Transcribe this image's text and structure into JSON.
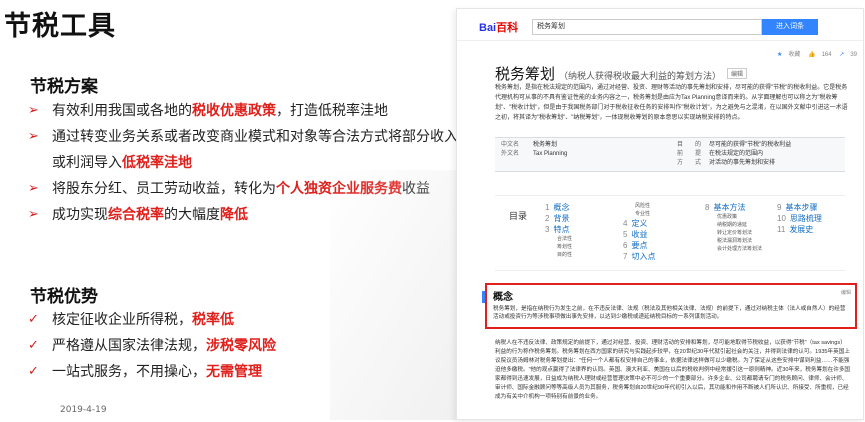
{
  "slide": {
    "title": "节税工具",
    "date": "2019-4-19"
  },
  "plan": {
    "title": "节税方案",
    "items": [
      {
        "t1": "有效利用我国或各地的",
        "h1": "税收优惠政策",
        "t2": "，打造低税率洼地"
      },
      {
        "t1": "通过转变业务关系或者改变商业模式和对象等合法方式将部分收入或利润导入",
        "h1": "低税率洼地",
        "t2": ""
      },
      {
        "t1": "将股东分红、员工劳动收益，转化为",
        "h1": "个人独资企业服务费",
        "t2": "收益"
      },
      {
        "t1": "成功实现",
        "h1": "综合税率",
        "t2": "的大幅度",
        "h2": "降低"
      }
    ]
  },
  "advantage": {
    "title": "节税优势",
    "items": [
      {
        "t1": "核定征收企业所得税，",
        "h1": "税率低"
      },
      {
        "t1": "严格遵从国家法律法规，",
        "h1": "涉税零风险"
      },
      {
        "t1": "一站式服务，不用操心，",
        "h1": "无需管理"
      }
    ]
  },
  "baike": {
    "logo_a": "Bai",
    "logo_b": "百科",
    "search_value": "税务筹划",
    "search_button": "进入词条",
    "stats": {
      "collect": "收藏",
      "likes": "164",
      "shares": "39"
    },
    "title": "税务筹划",
    "subtitle": "（纳税人获得税收最大利益的筹划方法）",
    "edit": "编辑",
    "intro": "税务筹划，是指在税法规定的范围内，通过对经营、投资、理财等活动的事先筹划和安排，尽可能的获得\"节税\"的税收利益。它是税务代理机构可从事的不具有鉴证性能的业务内容之一，税务筹划是由应为Tax Planning意译而来的。从字面理解也可以称之为\"税收筹划\"、\"税收计划\"，但是由于我国税务部门对于税收征收任务的安排叫作\"税收计划\"，为之避免与之混淆，在以国外文献中引进这一术语之初，将其译为\"税收筹划\"、\"纳税筹划\"，一体现税收筹划的原本意思以实现纳税安排的特点。",
    "info": [
      {
        "k": "中文名",
        "v": "税务筹划",
        "k2": "目　　的",
        "v2": "尽可能的获得\"节税\"的税收利益"
      },
      {
        "k": "外文名",
        "v": "Tax Planning",
        "k2": "前　　提",
        "v2": "在税法规定的范围内"
      },
      {
        "k": "",
        "v": "",
        "k2": "方　　式",
        "v2": "对活动的事先筹划和安排"
      }
    ],
    "toc_label": "目录",
    "toc": [
      {
        "n": "1",
        "label": "概念",
        "subs": []
      },
      {
        "n": "2",
        "label": "背景",
        "subs": []
      },
      {
        "n": "3",
        "label": "特点",
        "subs": [
          "合法性",
          "筹划性",
          "目的性"
        ]
      },
      {
        "n": "",
        "label": "",
        "subs": [
          "风险性",
          "专业性"
        ]
      },
      {
        "n": "4",
        "label": "定义",
        "subs": []
      },
      {
        "n": "5",
        "label": "收益",
        "subs": []
      },
      {
        "n": "6",
        "label": "要点",
        "subs": []
      },
      {
        "n": "7",
        "label": "切入点",
        "subs": []
      },
      {
        "n": "8",
        "label": "基本方法",
        "subs": [
          "优惠政策",
          "纳税期的递延",
          "转让定价筹划法",
          "税法漏洞筹划法",
          "会计处理方法筹划法"
        ]
      },
      {
        "n": "9",
        "label": "基本步骤",
        "subs": []
      },
      {
        "n": "10",
        "label": "思路梳理",
        "subs": []
      },
      {
        "n": "11",
        "label": "发展史",
        "subs": []
      }
    ],
    "concept_title": "概念",
    "concept_edit": "编辑",
    "concept_text": "税务筹划，是指在纳税行为发生之前，在不违反法律、法规（税法及其他相关法律、法规）的前提下，通过对纳税主体（法人或自然人）的经营活动或投资行为等涉税事项做出事先安排，以达到少缴税或递延纳税目标的一系列谋划活动。",
    "body": "纳税人在不违反法律、政策规定的前提下，通过对经营、投资、理财活动的安排和筹划，尽可能地取得节税收益，以获得\"节税\"（tax savings）利益的行为称作税务筹划。税务筹划在西方国家的研究与实践起步较早，在20世纪30年代就引起社会的关注，并得到法律的认可。1935年英国上议院议员汤姆林对税务筹划提出：\"任何一个人都有权安排自己的事业，依据法律这样做可以少缴税。为了保证从这些安排中谋到利益……不能强迫他多缴税。\"他的观点赢得了法律界的认同。英国、澳大利亚、美国在以后的税收判例中经常援引这一原则精神。近30年来，税务筹划在许多国家都得到迅速发展，日益成为纳税人理财或经营管理决策中必不可少的一个重要部分。许多企业、公司都聘请专门的税务顾问、律师、会计师、审计师、国际金融顾问等等高级人员为其服务，税务筹划自20世纪90年代初引入以后，其功能和作用不断被人们所认识、所接受、所重视，已经成为有关中介机构一项特别有前景的业务。"
  }
}
